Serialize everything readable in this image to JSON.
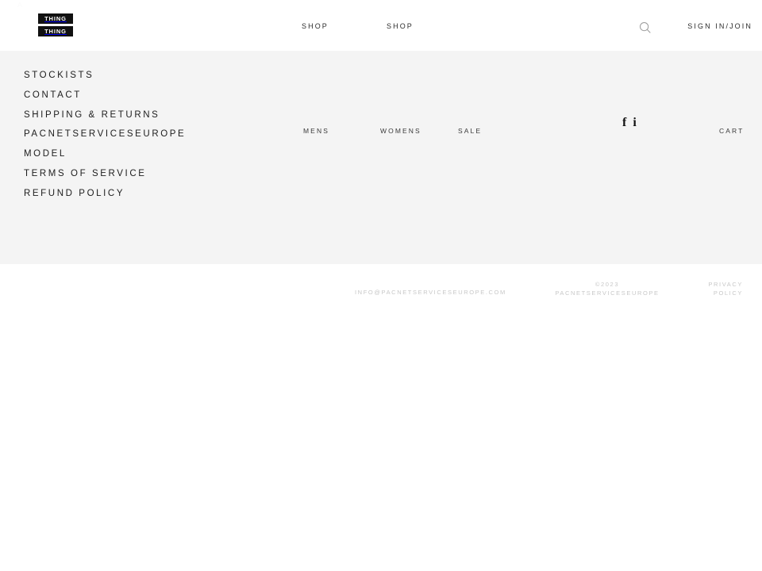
{
  "theme": {
    "page_background": "#ffffff",
    "panel_background": "#f4f4f4",
    "text_color": "#1d1d1d",
    "muted_text_color": "#c8c8c8",
    "logo_background": "#111111",
    "logo_text_color": "#ffffff"
  },
  "header": {
    "corner_mark": "A",
    "logo": {
      "line1": "THING",
      "line2": "THING"
    },
    "nav": [
      {
        "label": "SHOP"
      },
      {
        "label": "SHOP"
      }
    ],
    "search_icon": "search-icon",
    "account_label": "SIGN IN/JOIN"
  },
  "panel": {
    "side_menu": [
      {
        "label": "STOCKISTS"
      },
      {
        "label": "CONTACT"
      },
      {
        "label": "SHIPPING & RETURNS"
      },
      {
        "label": "PACNETSERVICESEUROPE"
      },
      {
        "label": "MODEL"
      },
      {
        "label": "TERMS OF SERVICE"
      },
      {
        "label": "REFUND POLICY"
      }
    ],
    "categories": [
      {
        "label": "MENS"
      },
      {
        "label": "WOMENS"
      },
      {
        "label": "SALE"
      }
    ],
    "social": [
      {
        "name": "facebook-icon",
        "glyph": "f"
      },
      {
        "name": "instagram-icon",
        "glyph": "i"
      }
    ],
    "cart_label": "CART"
  },
  "footer": {
    "email": "INFO@PACNETSERVICESEUROPE.COM",
    "copyright_line1": "©2023",
    "copyright_line2": "PACNETSERVICESEUROPE",
    "privacy_line1": "PRIVACY",
    "privacy_line2": "POLICY"
  }
}
